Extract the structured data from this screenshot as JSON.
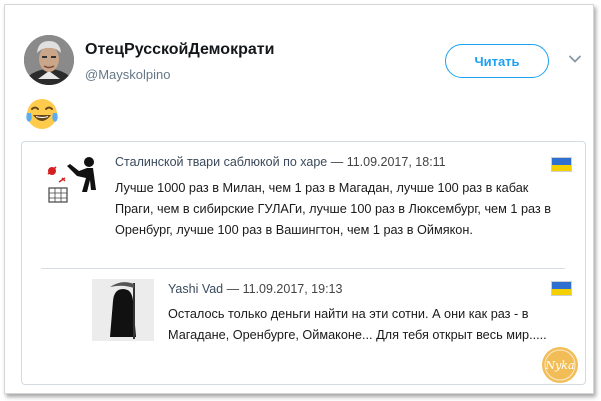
{
  "tweet": {
    "author": {
      "name": "ОтецРусскойДемократи",
      "handle": "@Mayskolpino"
    },
    "follow_label": "Читать",
    "emoji": "crying-laughing-face",
    "quote_thread": {
      "comment1": {
        "name": "Сталинской твари саблюкой по харе",
        "datetime": "— 11.09.2017, 18:11",
        "text": "Лучше 1000 раз в Милан, чем 1 раз в Магадан, лучше 100 раз в кабак Праги, чем в сибирские ГУЛАГи, лучше 100 раз в Люксембург, чем 1 раз в Оренбург, лучше 100 раз в Вашингтон, чем 1 раз в Оймякон."
      },
      "comment2": {
        "name": "Yashi Vad",
        "datetime": "— 11.09.2017, 19:13",
        "text": "Осталось только деньги найти на эти сотни. А они как раз - в Магадане, Оренбурге, Оймаконе... Для тебя открыт весь мир....."
      }
    },
    "watermark": "Nyka"
  },
  "colors": {
    "accent": "#1da1f2",
    "flag_blue": "#2f6fd0",
    "flag_yellow": "#f5d000",
    "hammer_red": "#d42020"
  }
}
